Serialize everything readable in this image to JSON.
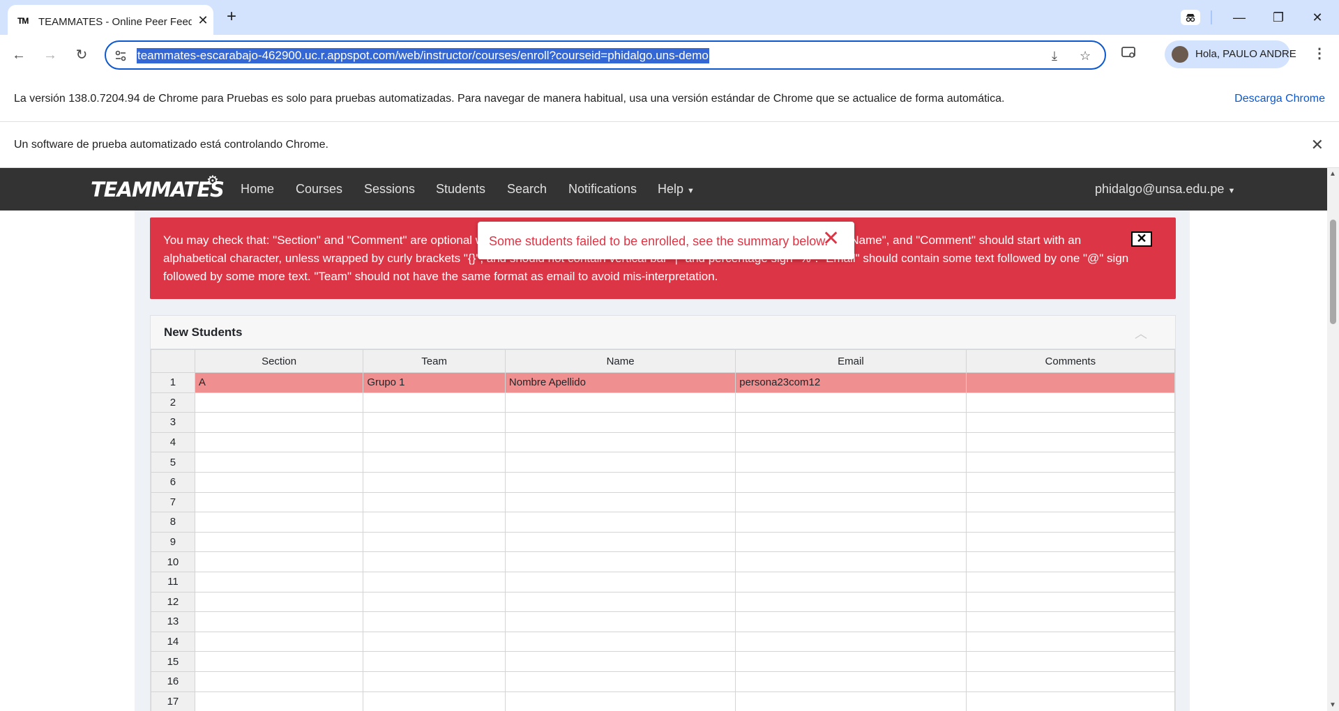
{
  "browser": {
    "tab_title": "TEAMMATES - Online Peer Feed",
    "tab_favicon_text": "TM",
    "url": "teammates-escarabajo-462900.uc.r.appspot.com/web/instructor/courses/enroll?courseid=phidalgo.uns-demo",
    "profile_name": "Hola, PAULO ANDRE",
    "infobar_version": "La versión 138.0.7204.94 de Chrome para Pruebas es solo para pruebas automatizadas. Para navegar de manera habitual, usa una versión estándar de Chrome que se actualice de forma automática.",
    "infobar_download_link": "Descarga Chrome",
    "infobar_automation": "Un software de prueba automatizado está controlando Chrome."
  },
  "navbar": {
    "logo": "TEAMMATES",
    "links": [
      "Home",
      "Courses",
      "Sessions",
      "Students",
      "Search",
      "Notifications",
      "Help"
    ],
    "user": "phidalgo@unsa.edu.pe"
  },
  "alert": {
    "text": "You may check that: \"Section\" and \"Comment\" are optional while \"Team\", \"Name\", and \"Email\" are compulsory. \"Section\", \"Team\", \"Name\", and \"Comment\" should start with an alphabetical character, unless wrapped by curly brackets \"{}\", and should not contain vertical bar \"|\" and percentage sign \"%\". \"Email\" should contain some text followed by one \"@\" sign followed by some more text. \"Team\" should not have the same format as email to avoid mis-interpretation.",
    "close_label": "✕"
  },
  "toast": {
    "message": "Some students failed to be enrolled, see the summary below."
  },
  "new_students": {
    "title": "New Students",
    "columns": [
      "Section",
      "Team",
      "Name",
      "Email",
      "Comments"
    ],
    "rows": [
      {
        "num": "1",
        "section": "A",
        "team": "Grupo 1",
        "name": "Nombre Apellido",
        "email": "persona23com12",
        "comments": ""
      },
      {
        "num": "2",
        "section": "",
        "team": "",
        "name": "",
        "email": "",
        "comments": ""
      },
      {
        "num": "3",
        "section": "",
        "team": "",
        "name": "",
        "email": "",
        "comments": ""
      },
      {
        "num": "4",
        "section": "",
        "team": "",
        "name": "",
        "email": "",
        "comments": ""
      },
      {
        "num": "5",
        "section": "",
        "team": "",
        "name": "",
        "email": "",
        "comments": ""
      },
      {
        "num": "6",
        "section": "",
        "team": "",
        "name": "",
        "email": "",
        "comments": ""
      },
      {
        "num": "7",
        "section": "",
        "team": "",
        "name": "",
        "email": "",
        "comments": ""
      },
      {
        "num": "8",
        "section": "",
        "team": "",
        "name": "",
        "email": "",
        "comments": ""
      },
      {
        "num": "9",
        "section": "",
        "team": "",
        "name": "",
        "email": "",
        "comments": ""
      },
      {
        "num": "10",
        "section": "",
        "team": "",
        "name": "",
        "email": "",
        "comments": ""
      },
      {
        "num": "11",
        "section": "",
        "team": "",
        "name": "",
        "email": "",
        "comments": ""
      },
      {
        "num": "12",
        "section": "",
        "team": "",
        "name": "",
        "email": "",
        "comments": ""
      },
      {
        "num": "13",
        "section": "",
        "team": "",
        "name": "",
        "email": "",
        "comments": ""
      },
      {
        "num": "14",
        "section": "",
        "team": "",
        "name": "",
        "email": "",
        "comments": ""
      },
      {
        "num": "15",
        "section": "",
        "team": "",
        "name": "",
        "email": "",
        "comments": ""
      },
      {
        "num": "16",
        "section": "",
        "team": "",
        "name": "",
        "email": "",
        "comments": ""
      },
      {
        "num": "17",
        "section": "",
        "team": "",
        "name": "",
        "email": "",
        "comments": ""
      }
    ]
  },
  "colors": {
    "navbar_bg": "#333333",
    "alert_bg": "#dc3545",
    "error_row_bg": "#f08f8f",
    "chrome_accent": "#0b57d0"
  }
}
